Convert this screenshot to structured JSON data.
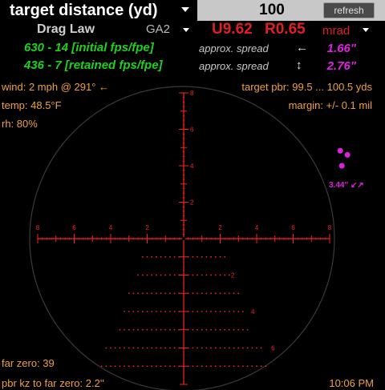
{
  "header": {
    "title": "target distance (yd)",
    "value": "100",
    "refresh_label": "refresh"
  },
  "drag": {
    "label": "Drag Law",
    "model": "GA2",
    "up": "U9.62",
    "right": "R0.65",
    "unit": "mrad"
  },
  "velocity": {
    "initial": "630 - 14 [initial fps/fpe]",
    "retained": "436 - 7 [retained fps/fpe]"
  },
  "spread": {
    "label1": "approx. spread",
    "label2": "approx. spread",
    "arrow1": "←",
    "arrow2": "↕",
    "horizontal": "1.66\"",
    "vertical": "2.76\""
  },
  "conditions": {
    "wind": "wind: 2 mph @ 291° ←",
    "temp": "temp: 48.5°F",
    "rh": "rh: 80%"
  },
  "target": {
    "pbr": "target pbr: 99.5 ... 100.5 yds",
    "margin": "margin: +/- 0.1 mil"
  },
  "footer": {
    "far_zero": "far zero: 39",
    "pbr_kz": "pbr kz to far zero: 2.2''",
    "time": "10:06 PM"
  },
  "reticle": {
    "color": "#ff2020",
    "group_color": "#e020e0",
    "group_label": "3.44'' ↙↗",
    "top_labels": [
      "8",
      "6",
      "4",
      "2"
    ],
    "horizontal_labels": [
      "8",
      "6",
      "4",
      "2",
      "2",
      "4",
      "6",
      "8"
    ],
    "lower_labels": [
      "2",
      "4",
      "6"
    ],
    "group_shots": [
      {
        "x": 3.94,
        "y": -1.6
      },
      {
        "x": 3.9,
        "y": -1.93
      },
      {
        "x": 4.08,
        "y": -1.84
      }
    ]
  }
}
